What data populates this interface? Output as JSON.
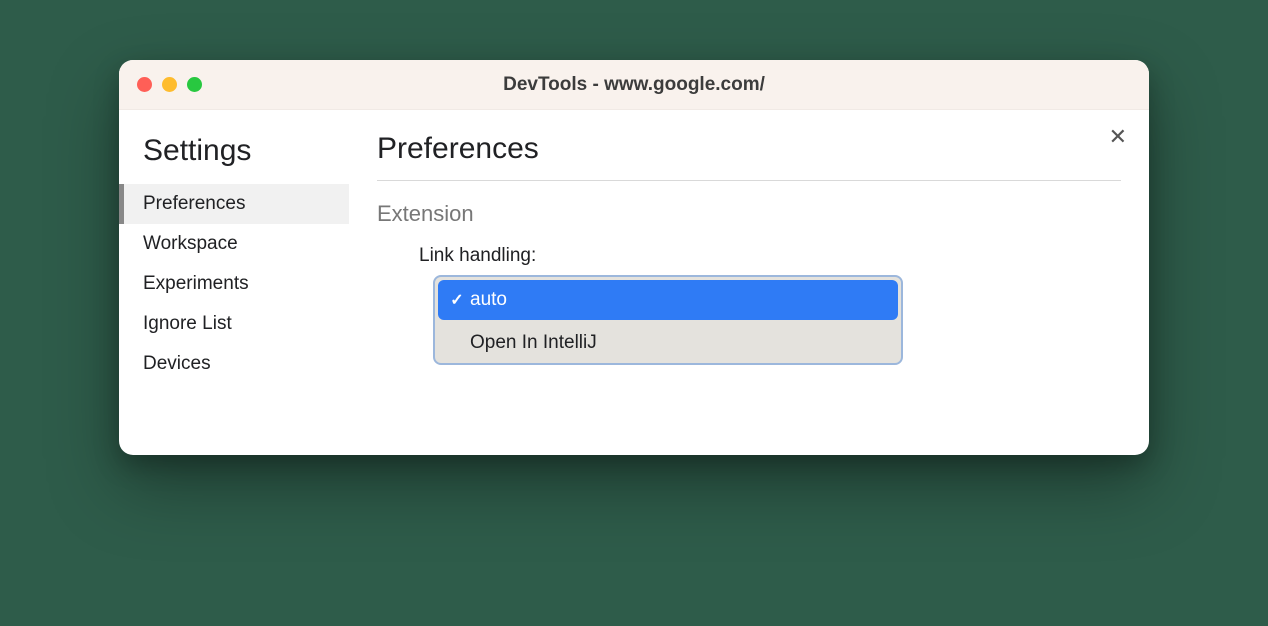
{
  "window": {
    "title": "DevTools - www.google.com/"
  },
  "sidebar": {
    "title": "Settings",
    "items": [
      {
        "label": "Preferences",
        "active": true
      },
      {
        "label": "Workspace",
        "active": false
      },
      {
        "label": "Experiments",
        "active": false
      },
      {
        "label": "Ignore List",
        "active": false
      },
      {
        "label": "Devices",
        "active": false
      }
    ]
  },
  "main": {
    "title": "Preferences",
    "section": "Extension",
    "field_label": "Link handling:",
    "dropdown": {
      "options": [
        {
          "label": "auto",
          "selected": true
        },
        {
          "label": "Open In IntelliJ",
          "selected": false
        }
      ]
    }
  },
  "icons": {
    "close": "✕",
    "check": "✓"
  }
}
